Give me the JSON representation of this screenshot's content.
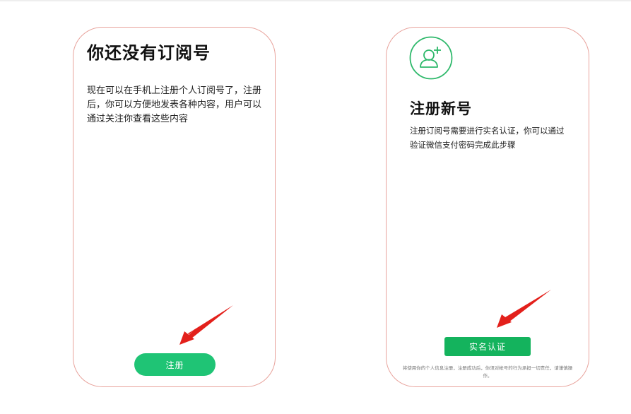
{
  "left_card": {
    "title": "你还没有订阅号",
    "description": "现在可以在手机上注册个人订阅号了，注册后，你可以方便地发表各种内容，用户可以通过关注你查看这些内容",
    "register_button": "注册"
  },
  "right_card": {
    "icon": "add-user-icon",
    "title": "注册新号",
    "description": "注册订阅号需要进行实名认证，你可以通过验证微信支付密码完成此步骤",
    "verify_button": "实名认证",
    "footnote": "将使用你的个人信息注册，注册成功后，你须对帐号的行为承担一切责任，请谨慎操作。"
  },
  "colors": {
    "card_border": "#e8a39c",
    "button_green": "#1fc475",
    "verify_green": "#14b35d",
    "icon_green": "#2db86a",
    "arrow_red": "#e3201b"
  }
}
